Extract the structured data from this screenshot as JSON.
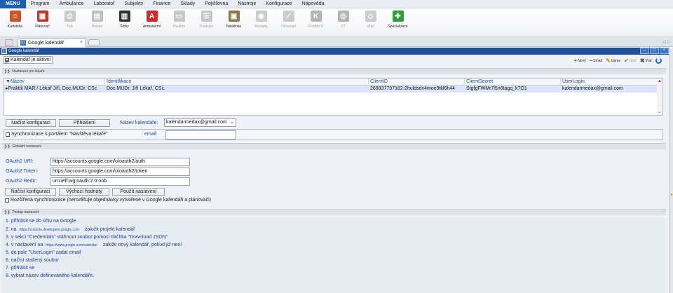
{
  "menubar": {
    "main": "MENU",
    "items": [
      "Program",
      "Ambulance",
      "Laboratoř",
      "Subjekty",
      "Finance",
      "Sklady",
      "Pojišťovna",
      "Nástroje",
      "Konfigurace",
      "Nápověda"
    ]
  },
  "toolbar": {
    "buttons": [
      {
        "label": "Kartotéka",
        "icon": "people-icon",
        "color": "#c9562b",
        "enabled": true
      },
      {
        "label": "Plánovač",
        "icon": "calendar-icon",
        "color": "#c0392b",
        "enabled": true
      },
      {
        "label": "Tisk",
        "icon": "printer-icon",
        "color": "#707070",
        "enabled": false
      },
      {
        "label": "Dekurz",
        "icon": "document-stamp-icon",
        "color": "#555555",
        "enabled": false
      },
      {
        "label": "Štítky",
        "icon": "barcode-icon",
        "color": "#333333",
        "enabled": true
      },
      {
        "label": "Ambulantní",
        "icon": "letter-a-icon",
        "color": "#d02b2b",
        "enabled": true
      },
      {
        "label": "Poukaz",
        "icon": "voucher-icon",
        "color": "#6b6b6b",
        "enabled": false
      },
      {
        "label": "Poukázk",
        "icon": "voucher-list-icon",
        "color": "#6b6b6b",
        "enabled": false
      },
      {
        "label": "Nástěnka",
        "icon": "clipboard-icon",
        "color": "#8a7a4a",
        "enabled": true
      },
      {
        "label": "Recepty",
        "icon": "pills-icon",
        "color": "#777777",
        "enabled": false
      },
      {
        "label": "Očkování",
        "icon": "syringe-icon",
        "color": "#777777",
        "enabled": false
      },
      {
        "label": "Poukaz K",
        "icon": "letter-k-icon",
        "color": "#333333",
        "enabled": false
      },
      {
        "label": "CT",
        "icon": "ct-scanner-icon",
        "color": "#333333",
        "enabled": false
      },
      {
        "label": "Úhel",
        "icon": "angle-icon",
        "color": "#777777",
        "enabled": false
      },
      {
        "label": "Specializace",
        "icon": "puzzle-icon",
        "color": "#2e9e3a",
        "enabled": true
      }
    ]
  },
  "tabs": {
    "active_title": "Google kalendář",
    "close_glyph": "×"
  },
  "window": {
    "title": "Google kalendář",
    "controls": [
      "–",
      "□",
      "×"
    ]
  },
  "main": {
    "active_checkbox_label": "Kalendář je aktivní",
    "active_checked": true,
    "actions": [
      {
        "label": "Nový",
        "icon": "plus-icon",
        "color": "#2e9e3a",
        "enabled": true
      },
      {
        "label": "Smaž",
        "icon": "minus-icon",
        "color": "#d02b2b",
        "enabled": true
      },
      {
        "label": "Uprav",
        "icon": "pencil-icon",
        "color": "#c8a100",
        "enabled": true
      },
      {
        "label": "Ulož",
        "icon": "check-icon",
        "color": "#888888",
        "enabled": false
      },
      {
        "label": "Vrať",
        "icon": "cross-icon",
        "color": "#555555",
        "enabled": true
      }
    ],
    "section_doctor": "Nastavení pro lékaře",
    "grid": {
      "columns": [
        "Název",
        "Identifikace",
        "ClientID",
        "ClientSecret",
        "UserLogin"
      ],
      "rows": [
        [
          "Praktik MAR / Lékař Jiří, Doc.MUDr. CSc",
          "Doc.MUDr. Jiří Lékař, CSc.",
          "266837797182-2huldsdv4moe9tkl6h44",
          "StgfgFWMr7l5n6tagq_k7O1",
          "kalendarmedax@gmail.com"
        ]
      ]
    },
    "load_config_button": "Načíst konfiguraci",
    "login_button": "Přihlášení",
    "calendar_name_label": "Název kalendáře:",
    "calendar_name_value": "kalendarmedax@gmail.com",
    "sync_label": "Synchronizace s portálem \"Návštěva lékaře\"",
    "sync_checked": false,
    "email_label": "email:",
    "email_value": "",
    "section_global": "Globální nastavení",
    "oauth": {
      "uri_label": "OAuth2 URI:",
      "uri_value": "https://accounts.google.com/o/oauth2/auth",
      "token_label": "OAuth2 Token:",
      "token_value": "https://accounts.google.com/o/oauth2/token",
      "redir_label": "OAuth2 Redir:",
      "redir_value": "urn:ietf:wg:oauth:2.0:oob"
    },
    "global_load_button": "Načíst konfiguraci",
    "defaults_button": "Výchozí hodnoty",
    "apply_button": "Použít nastavení",
    "extended_sync_label": "Rozšířená synchronizace (nerozlišuje objednávky vytvořené v Google kalendáři a plánovači)",
    "extended_sync_checked": false,
    "section_steps": "Postup nastavení",
    "steps": [
      {
        "text": "1. přihlásit se do účtu na Google"
      },
      {
        "text": "2. na",
        "link": "https://console.developers.google.com",
        "after": "založit projekt kalendář"
      },
      {
        "text": "3. v sekci \"Credentials\" stáhnout soubor pomocí tlačítka \"Download JSON\""
      },
      {
        "text": "4. v nastavení na",
        "link": "https://www.google.com/calendar",
        "after": "založit nový kalendář, pokud již není"
      },
      {
        "text": "5. do pole \"UserLogin\" zadat email"
      },
      {
        "text": "6. načíst stažený soubor"
      },
      {
        "text": "7. přihlásit se"
      },
      {
        "text": "8. vybrat název definovaného kalendáře."
      }
    ]
  }
}
